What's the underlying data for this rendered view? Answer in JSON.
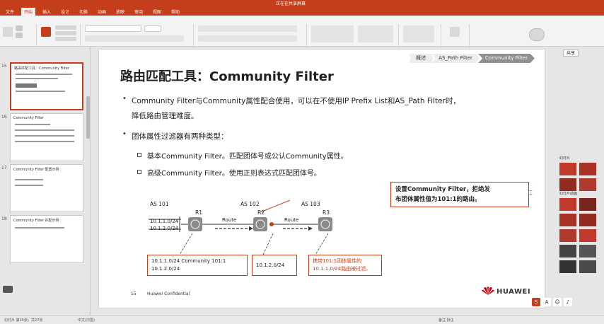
{
  "window": {
    "title": "正在在共享屏幕"
  },
  "ribbon": {
    "tabs": [
      "文件",
      "开始",
      "插入",
      "设计",
      "切换",
      "动画",
      "放映",
      "审阅",
      "视图",
      "帮助"
    ],
    "active_tab_index": 1,
    "share_label": "共享"
  },
  "thumbnails": [
    {
      "number": "15",
      "title": "路由匹配工具：Community Filter",
      "active": true
    },
    {
      "number": "16",
      "title": "Community Filter",
      "active": false
    },
    {
      "number": "17",
      "title": "Community Filter 配置示例",
      "active": false
    },
    {
      "number": "18",
      "title": "Community Filter 匹配示例",
      "active": false
    }
  ],
  "slide": {
    "breadcrumbs": [
      "概述",
      "AS_Path Filter",
      "Community Filter"
    ],
    "active_breadcrumb_index": 2,
    "title": "路由匹配工具：Community Filter",
    "bullets": [
      {
        "line1": "Community Filter与Community属性配合使用，可以在不使用IP Prefix List和AS_Path Filter时，",
        "line2": "降低路由管理难度。"
      },
      {
        "line1": "团体属性过滤器有两种类型：",
        "line2": ""
      }
    ],
    "sub_bullets": [
      "基本Community Filter。匹配团体号或公认Community属性。",
      "高级Community Filter。使用正则表达式匹配团体号。"
    ],
    "diagram": {
      "as_labels": [
        "AS 101",
        "AS 102",
        "AS 103"
      ],
      "routers": [
        "R1",
        "R2",
        "R3"
      ],
      "r1_networks": [
        "10.1.1.0/24",
        "10.1.2.0/24"
      ],
      "route_labels": [
        "Route",
        "Route"
      ],
      "box_left": [
        "10.1.1.0/24 Community 101:1",
        "10.1.2.0/24"
      ],
      "box_mid": [
        "10.1.2.0/24"
      ],
      "box_right": [
        "携带101:1团体属性的",
        "10.1.1.0/24路由被过滤。"
      ],
      "callout": [
        "设置Community Filter，拒绝发",
        "布团体属性值为101:1的路由。"
      ]
    },
    "footer_page": "15",
    "footer_text": "Huawei Confidential",
    "logo_text": "HUAWEI"
  },
  "right_pane": {
    "section1": "幻灯片",
    "section2": "幻灯片动画"
  },
  "status": {
    "left": "幻灯片 第15张，共27张",
    "mid": "中文(中国)",
    "right": "备注   批注"
  },
  "colors": {
    "accent": "#c43e1c",
    "router": "#8a8a8a"
  }
}
